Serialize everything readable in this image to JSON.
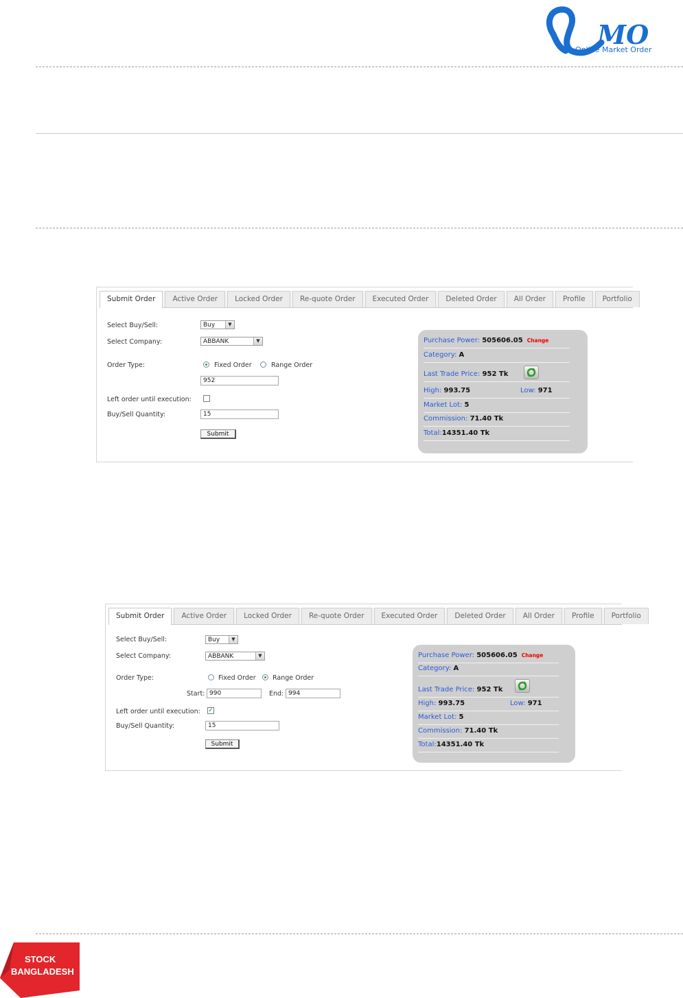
{
  "logo": {
    "letters": "MO",
    "tagline": "Online Market Order"
  },
  "tabs": [
    "Submit Order",
    "Active Order",
    "Locked Order",
    "Re-quote Order",
    "Executed Order",
    "Deleted Order",
    "All Order",
    "Profile",
    "Portfolio"
  ],
  "form_labels": {
    "buy_sell": "Select Buy/Sell:",
    "company": "Select Company:",
    "order_type": "Order Type:",
    "left_order": "Left order until execution:",
    "quantity": "Buy/Sell Quantity:",
    "fixed": "Fixed Order",
    "range": "Range Order",
    "start": "Start:",
    "end": "End:",
    "submit": "Submit"
  },
  "order1": {
    "buy_sell": "Buy",
    "company": "ABBANK",
    "order_type": "Fixed Order",
    "price": "952",
    "left_until_execution": false,
    "quantity": "15"
  },
  "order2": {
    "buy_sell": "Buy",
    "company": "ABBANK",
    "order_type": "Range Order",
    "start": "990",
    "end": "994",
    "left_until_execution": true,
    "quantity": "15"
  },
  "info": {
    "purchase_power_label": "Purchase Power:",
    "purchase_power": "505606.05",
    "change": "Change",
    "category_label": "Category:",
    "category": "A",
    "last_trade_label": "Last Trade Price:",
    "last_trade": "952 Tk",
    "high_label": "High:",
    "high": "993.75",
    "low_label": "Low:",
    "low": "971",
    "market_lot_label": "Market Lot:",
    "market_lot": "5",
    "commission_label": "Commission:",
    "commission": "71.40 Tk",
    "total_label": "Total:",
    "total": "14351.40 Tk"
  },
  "badge": {
    "line1": "STOCK",
    "line2": "BANGLADESH"
  },
  "colors": {
    "logo_blue": "#1a6fd0",
    "badge_red": "#e2262b",
    "link_blue": "#2a5bd7",
    "change_red": "#e00000"
  }
}
